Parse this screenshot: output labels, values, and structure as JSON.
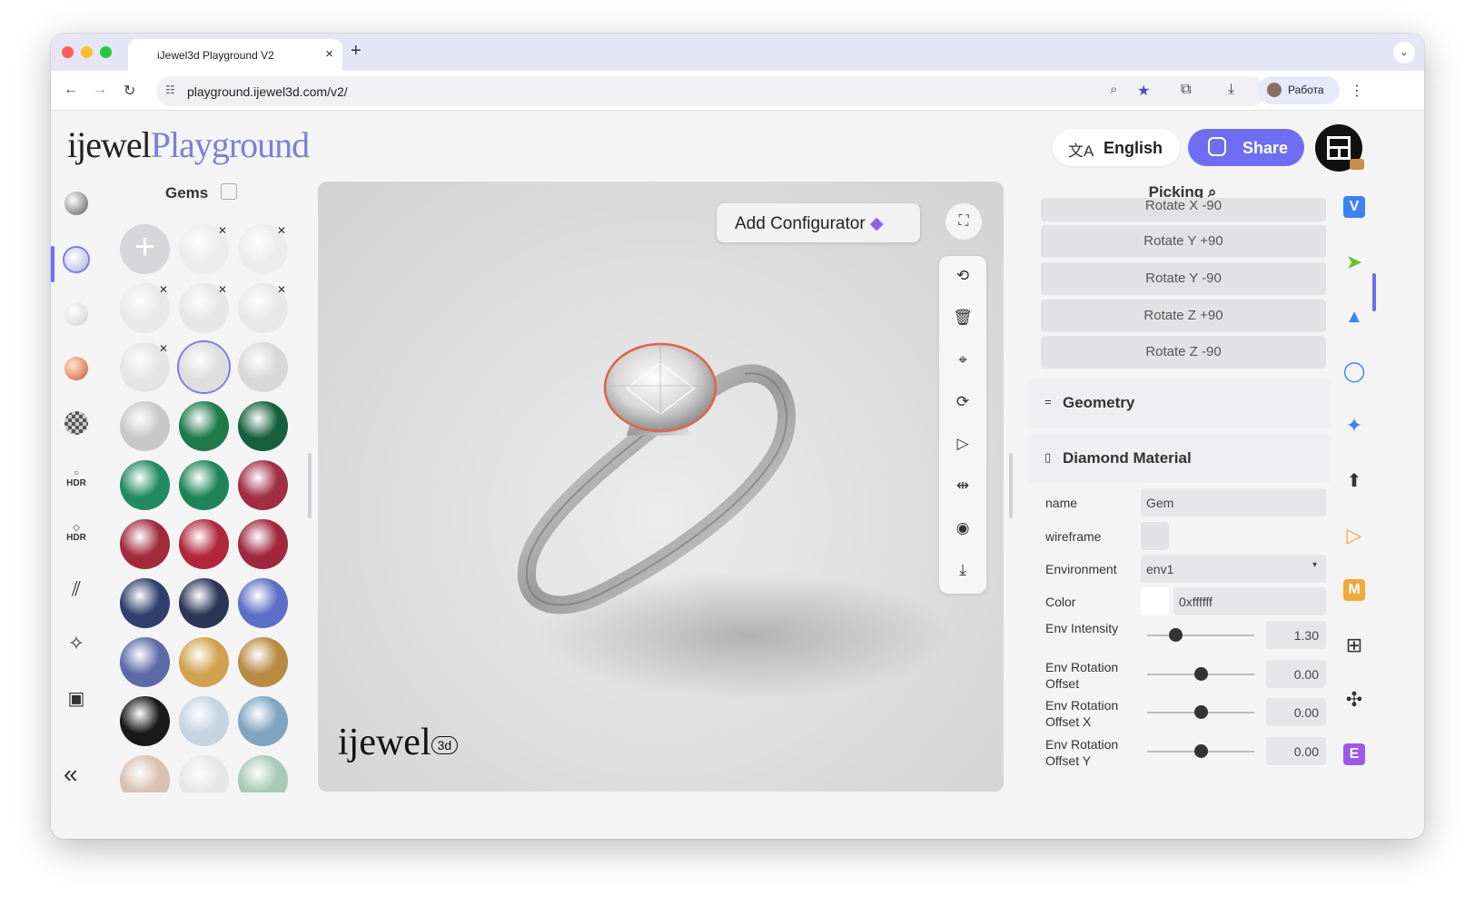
{
  "browser": {
    "tab_title": "iJewel3d Playground V2",
    "tab_close": "×",
    "new_tab": "+",
    "tab_menu": "⌄",
    "url": "playground.ijewel3d.com/v2/",
    "profile_name": "Работа",
    "traffic_lights": [
      "#ff5f57",
      "#febc2e",
      "#28c840"
    ]
  },
  "header": {
    "logo_part1": "ijewel",
    "logo_part2": "Playground",
    "language_label": "English",
    "share_label": "Share",
    "accent_color": "#6e6ef2"
  },
  "left_sidebar": {
    "items": [
      {
        "name": "metal-icon"
      },
      {
        "name": "gem-icon",
        "active": true
      },
      {
        "name": "pearl-icon"
      },
      {
        "name": "rose-gold-icon"
      },
      {
        "name": "pattern-icon"
      },
      {
        "name": "hdr-ring-icon",
        "label": "HDR"
      },
      {
        "name": "hdr-diamond-icon",
        "label": "HDR"
      },
      {
        "name": "stripes-icon"
      },
      {
        "name": "sparkle-icon"
      },
      {
        "name": "background-image-icon"
      }
    ],
    "collapse_label": "«"
  },
  "gems_panel": {
    "title": "Gems",
    "items": [
      {
        "type": "add",
        "color": "#d6d6d9"
      },
      {
        "color": "#ececec",
        "removable": true
      },
      {
        "color": "#ececec",
        "removable": true
      },
      {
        "color": "#e9e9e9",
        "removable": true
      },
      {
        "color": "#e6e6e6",
        "removable": true
      },
      {
        "color": "#e8e8e8",
        "removable": true
      },
      {
        "color": "#e4e4e4",
        "removable": true
      },
      {
        "color": "#dedede",
        "selected": true
      },
      {
        "color": "#d8d8d8"
      },
      {
        "color": "#c8c8c8"
      },
      {
        "color": "#1f7a4a"
      },
      {
        "color": "#16603e"
      },
      {
        "color": "#228a63"
      },
      {
        "color": "#1e8458"
      },
      {
        "color": "#a02e44"
      },
      {
        "color": "#a22b3b"
      },
      {
        "color": "#b2263b"
      },
      {
        "color": "#a0273f"
      },
      {
        "color": "#2f3f6e"
      },
      {
        "color": "#2a3558"
      },
      {
        "color": "#5b6fc4"
      },
      {
        "color": "#5c6aa8"
      },
      {
        "color": "#d0a24e"
      },
      {
        "color": "#b88a42"
      },
      {
        "color": "#1a1a1a"
      },
      {
        "color": "#c6d4e0"
      },
      {
        "color": "#7ea4c0"
      },
      {
        "color": "#d9c0b0"
      },
      {
        "color": "#e6e6e6"
      },
      {
        "color": "#a8c8b8"
      }
    ]
  },
  "viewport": {
    "add_configurator_label": "Add Configurator",
    "expand_icon": "⛶",
    "tools": [
      {
        "name": "rotate-left-icon",
        "glyph": "⟲"
      },
      {
        "name": "delete-icon",
        "glyph": "🗑"
      },
      {
        "name": "focus-icon",
        "glyph": "⌖"
      },
      {
        "name": "rotate-right-icon",
        "glyph": "⟳"
      },
      {
        "name": "play-icon",
        "glyph": "▷"
      },
      {
        "name": "move-icon",
        "glyph": "⇹"
      },
      {
        "name": "camera-icon",
        "glyph": "◉"
      },
      {
        "name": "download-icon",
        "glyph": "⤓"
      }
    ],
    "brand_text": "ijewel",
    "brand_tag": "3d"
  },
  "right_panel": {
    "picking_title": "Picking",
    "rotate_buttons": [
      "Rotate X -90",
      "Rotate Y +90",
      "Rotate Y -90",
      "Rotate Z +90",
      "Rotate Z -90"
    ],
    "geometry_label": "Geometry",
    "geometry_icon": "=",
    "material_label": "Diamond Material",
    "material_icon": "▯",
    "props": {
      "name_label": "name",
      "name_value": "Gem",
      "wireframe_label": "wireframe",
      "environment_label": "Environment",
      "environment_value": "env1",
      "color_label": "Color",
      "color_value": "0xffffff",
      "env_intensity_label": "Env Intensity",
      "env_intensity_value": "1.30",
      "env_intensity_level": 0.26,
      "env_rot_label": "Env Rotation Offset",
      "env_rot_value": "0.00",
      "env_rot_level": 0.5,
      "env_rot_x_label": "Env Rotation Offset X",
      "env_rot_x_value": "0.00",
      "env_rot_x_level": 0.5,
      "env_rot_y_label": "Env Rotation Offset Y",
      "env_rot_y_value": "0.00",
      "env_rot_y_level": 0.5
    }
  },
  "right_sidebar": {
    "items": [
      {
        "name": "v-plugin-icon",
        "letter": "V",
        "color": "#3b82f6"
      },
      {
        "name": "pointer-icon",
        "active": true
      },
      {
        "name": "shapes-icon"
      },
      {
        "name": "circle-icon"
      },
      {
        "name": "star-icon"
      },
      {
        "name": "upload-icon"
      },
      {
        "name": "play-icon"
      },
      {
        "name": "m-plugin-icon",
        "letter": "M",
        "color": "#f2a93b"
      },
      {
        "name": "grid-icon"
      },
      {
        "name": "puzzle-icon"
      },
      {
        "name": "e-plugin-icon",
        "letter": "E",
        "color": "#9b59e6"
      }
    ]
  }
}
